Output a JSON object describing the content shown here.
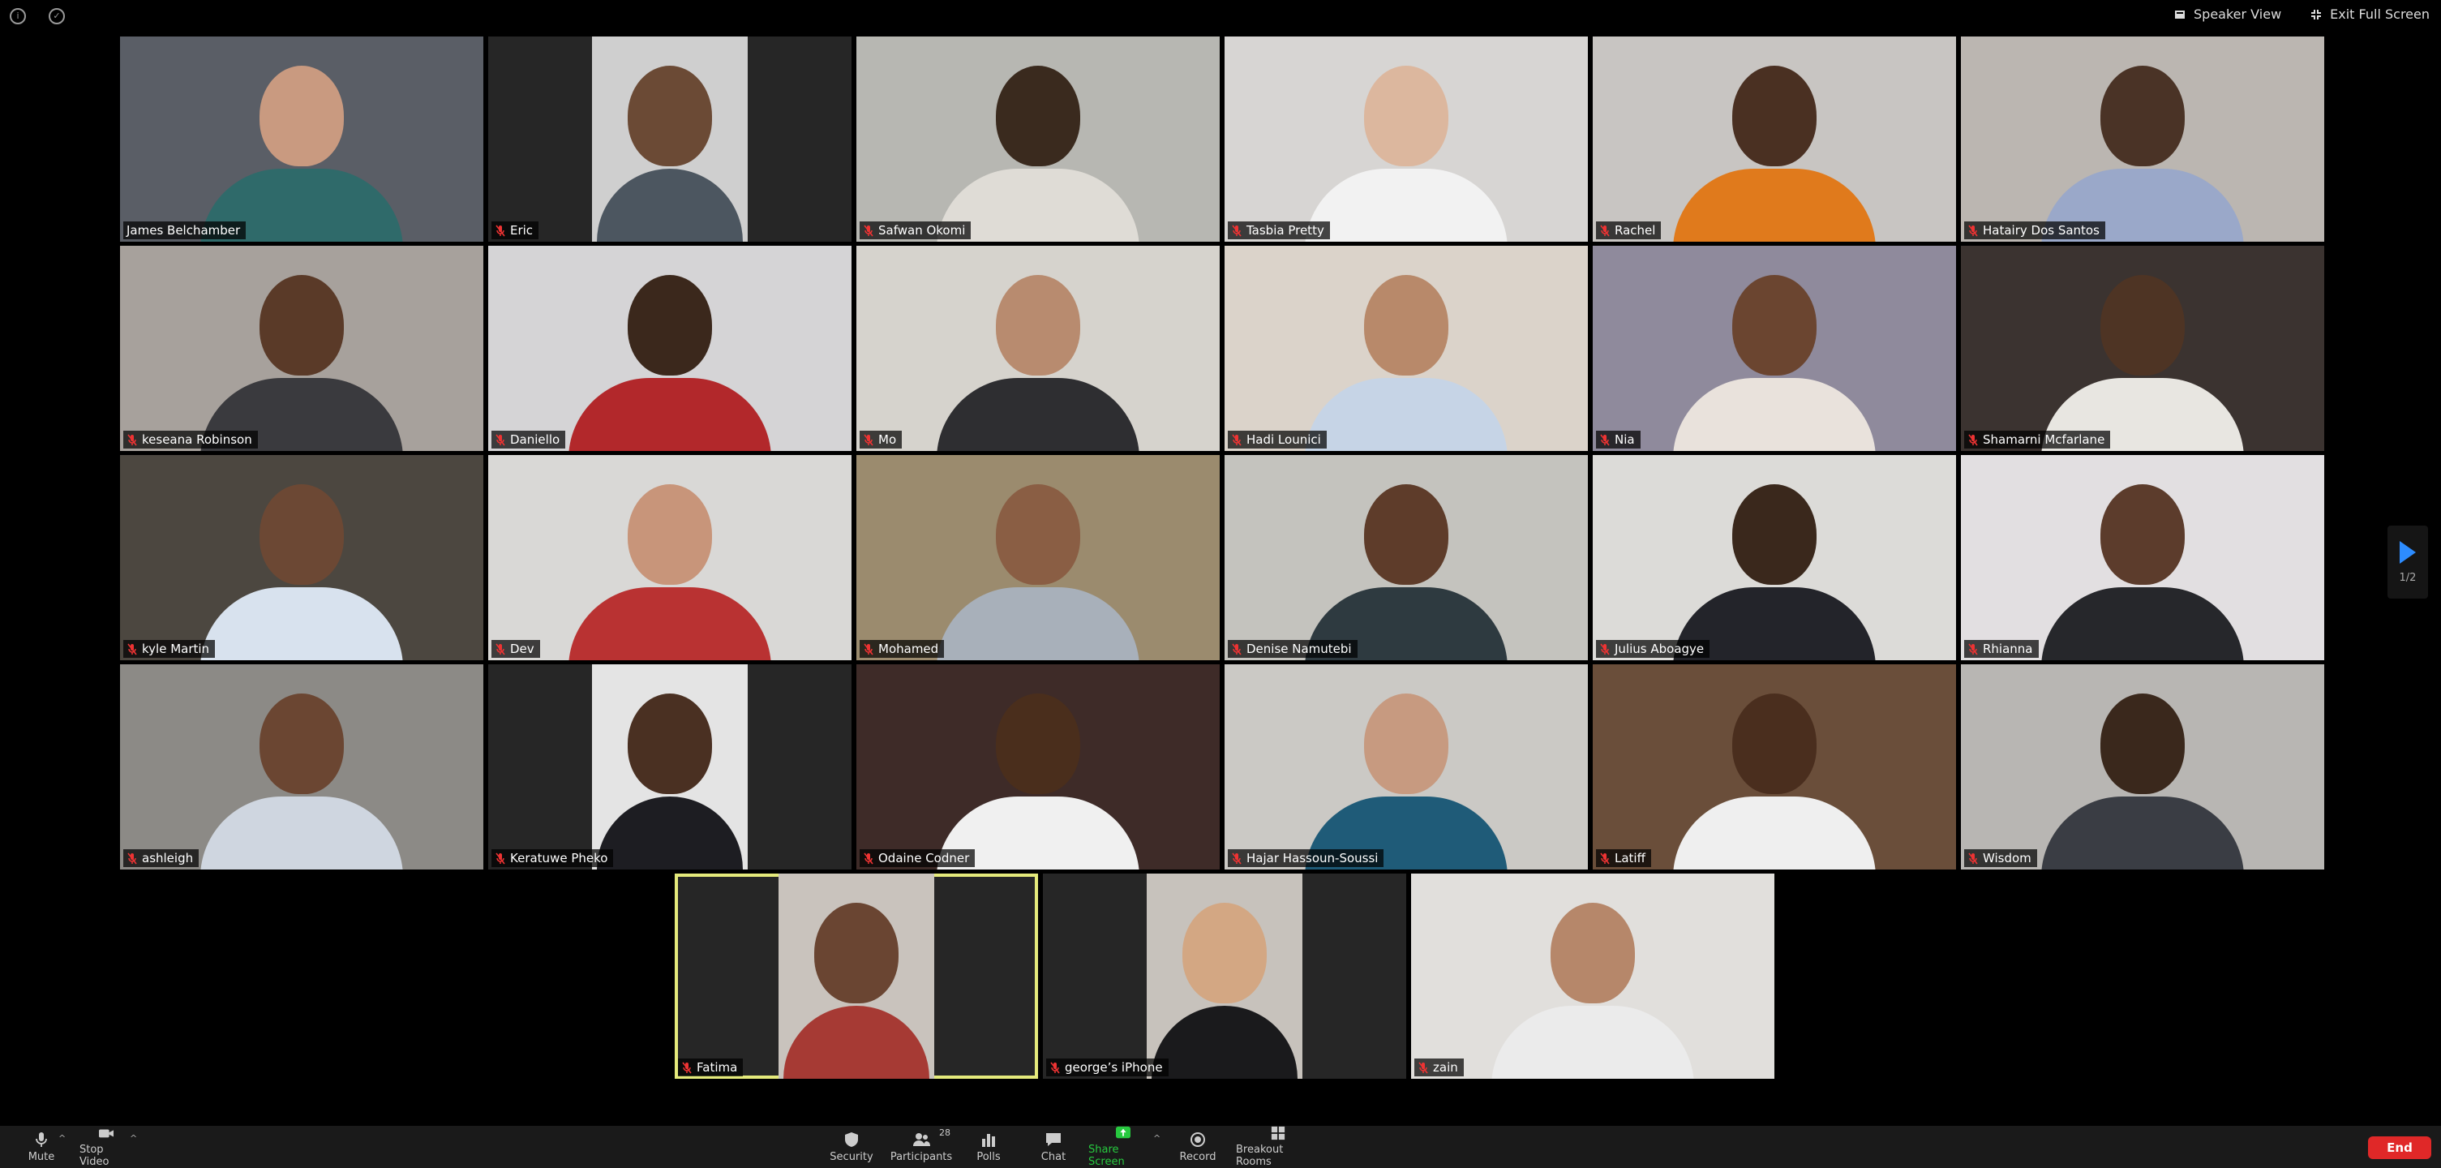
{
  "top_bar": {
    "speaker_view_label": "Speaker View",
    "exit_full_screen_label": "Exit Full Screen"
  },
  "participants": [
    {
      "name": "James Belchamber",
      "muted": false,
      "active": false,
      "bg": "#5a5e66",
      "skin": "#c99a80",
      "shirt": "#2f6a6a",
      "layout": "full"
    },
    {
      "name": "Eric",
      "muted": true,
      "active": false,
      "bg": "#cfcfcf",
      "skin": "#6b4a35",
      "shirt": "#4c5660",
      "layout": "narrow"
    },
    {
      "name": "Safwan Okomi",
      "muted": true,
      "active": false,
      "bg": "#b7b7b2",
      "skin": "#3a2a1e",
      "shirt": "#dfdcd6",
      "layout": "full"
    },
    {
      "name": "Tasbia Pretty",
      "muted": true,
      "active": true,
      "bg": "#d7d5d3",
      "skin": "#dcb79e",
      "shirt": "#f2f2f2",
      "layout": "full"
    },
    {
      "name": "Rachel",
      "muted": true,
      "active": false,
      "bg": "#c8c5c2",
      "skin": "#4a3022",
      "shirt": "#e07a1c",
      "layout": "full"
    },
    {
      "name": "Hatairy Dos Santos",
      "muted": true,
      "active": false,
      "bg": "#bbb6b1",
      "skin": "#4a3326",
      "shirt": "#9aa8c9",
      "layout": "full"
    },
    {
      "name": "keseana Robinson",
      "muted": true,
      "active": false,
      "bg": "#a7a19c",
      "skin": "#5a3a28",
      "shirt": "#3a3a3e",
      "layout": "full"
    },
    {
      "name": "Daniello",
      "muted": true,
      "active": false,
      "bg": "#d5d4d6",
      "skin": "#3b281c",
      "shirt": "#b2282b",
      "layout": "full"
    },
    {
      "name": "Mo",
      "muted": true,
      "active": false,
      "bg": "#d6d3cd",
      "skin": "#b88b6f",
      "shirt": "#2e2e31",
      "layout": "full"
    },
    {
      "name": "Hadi Lounici",
      "muted": true,
      "active": false,
      "bg": "#dbd3ca",
      "skin": "#b8896a",
      "shirt": "#c6d4e6",
      "layout": "full"
    },
    {
      "name": "Nia",
      "muted": true,
      "active": false,
      "bg": "#8f8a9c",
      "skin": "#6b4530",
      "shirt": "#e9e2dc",
      "layout": "full"
    },
    {
      "name": "Shamarni Mcfarlane",
      "muted": true,
      "active": false,
      "bg": "#3b3330",
      "skin": "#4e3424",
      "shirt": "#e8e6e1",
      "layout": "full"
    },
    {
      "name": "kyle Martin",
      "muted": true,
      "active": false,
      "bg": "#4c4740",
      "skin": "#6c4834",
      "shirt": "#d8e2ee",
      "layout": "full"
    },
    {
      "name": "Dev",
      "muted": true,
      "active": false,
      "bg": "#d9d8d6",
      "skin": "#c8957a",
      "shirt": "#b93232",
      "layout": "full"
    },
    {
      "name": "Mohamed",
      "muted": true,
      "active": false,
      "bg": "#9b8b6e",
      "skin": "#8a5e44",
      "shirt": "#a8b0ba",
      "layout": "full"
    },
    {
      "name": "Denise Namutebi",
      "muted": true,
      "active": false,
      "bg": "#c4c3be",
      "skin": "#5e3c2a",
      "shirt": "#2e3a40",
      "layout": "full"
    },
    {
      "name": "Julius Aboagye",
      "muted": true,
      "active": false,
      "bg": "#dcdbd8",
      "skin": "#3a281c",
      "shirt": "#23242a",
      "layout": "full"
    },
    {
      "name": "Rhianna",
      "muted": true,
      "active": false,
      "bg": "#e2dfe1",
      "skin": "#5c3c2c",
      "shirt": "#26272b",
      "layout": "full"
    },
    {
      "name": "ashleigh",
      "muted": true,
      "active": false,
      "bg": "#8c8a86",
      "skin": "#6b4632",
      "shirt": "#cfd6e0",
      "layout": "full"
    },
    {
      "name": "Keratuwe Pheko",
      "muted": true,
      "active": false,
      "bg": "#e4e4e4",
      "skin": "#4a3022",
      "shirt": "#1d1d22",
      "layout": "narrow"
    },
    {
      "name": "Odaine Codner",
      "muted": true,
      "active": false,
      "bg": "#3e2b28",
      "skin": "#4a2e1c",
      "shirt": "#f0f0f0",
      "layout": "full"
    },
    {
      "name": "Hajar Hassoun-Soussi",
      "muted": true,
      "active": false,
      "bg": "#cbc9c5",
      "skin": "#c79a80",
      "shirt": "#1f5b78",
      "layout": "full"
    },
    {
      "name": "Latiff",
      "muted": true,
      "active": false,
      "bg": "#6a4e3a",
      "skin": "#4a2e1e",
      "shirt": "#efefef",
      "layout": "full"
    },
    {
      "name": "Wisdom",
      "muted": true,
      "active": false,
      "bg": "#b8b6b3",
      "skin": "#3a281c",
      "shirt": "#3a3d44",
      "layout": "full"
    },
    {
      "name": "Fatima",
      "muted": true,
      "active": true,
      "bg": "#c9c3bd",
      "skin": "#6a4532",
      "shirt": "#a63a34",
      "layout": "narrow"
    },
    {
      "name": "george’s iPhone",
      "muted": true,
      "active": false,
      "bg": "#c7c2bc",
      "skin": "#d3a783",
      "shirt": "#1a1a1c",
      "layout": "narrow"
    },
    {
      "name": "zain",
      "muted": true,
      "active": false,
      "bg": "#e1dfdc",
      "skin": "#b6876a",
      "shirt": "#ebebeb",
      "layout": "full"
    }
  ],
  "pager": {
    "label": "1/2"
  },
  "toolbar": {
    "mute_label": "Mute",
    "stop_video_label": "Stop Video",
    "security_label": "Security",
    "participants_label": "Participants",
    "participants_count": "28",
    "polls_label": "Polls",
    "chat_label": "Chat",
    "share_screen_label": "Share Screen",
    "record_label": "Record",
    "breakout_rooms_label": "Breakout Rooms",
    "end_label": "End"
  },
  "colors": {
    "active_speaker": "#e5ea7c",
    "share": "#27c93f",
    "end": "#e02828",
    "accent": "#2d8cff"
  }
}
